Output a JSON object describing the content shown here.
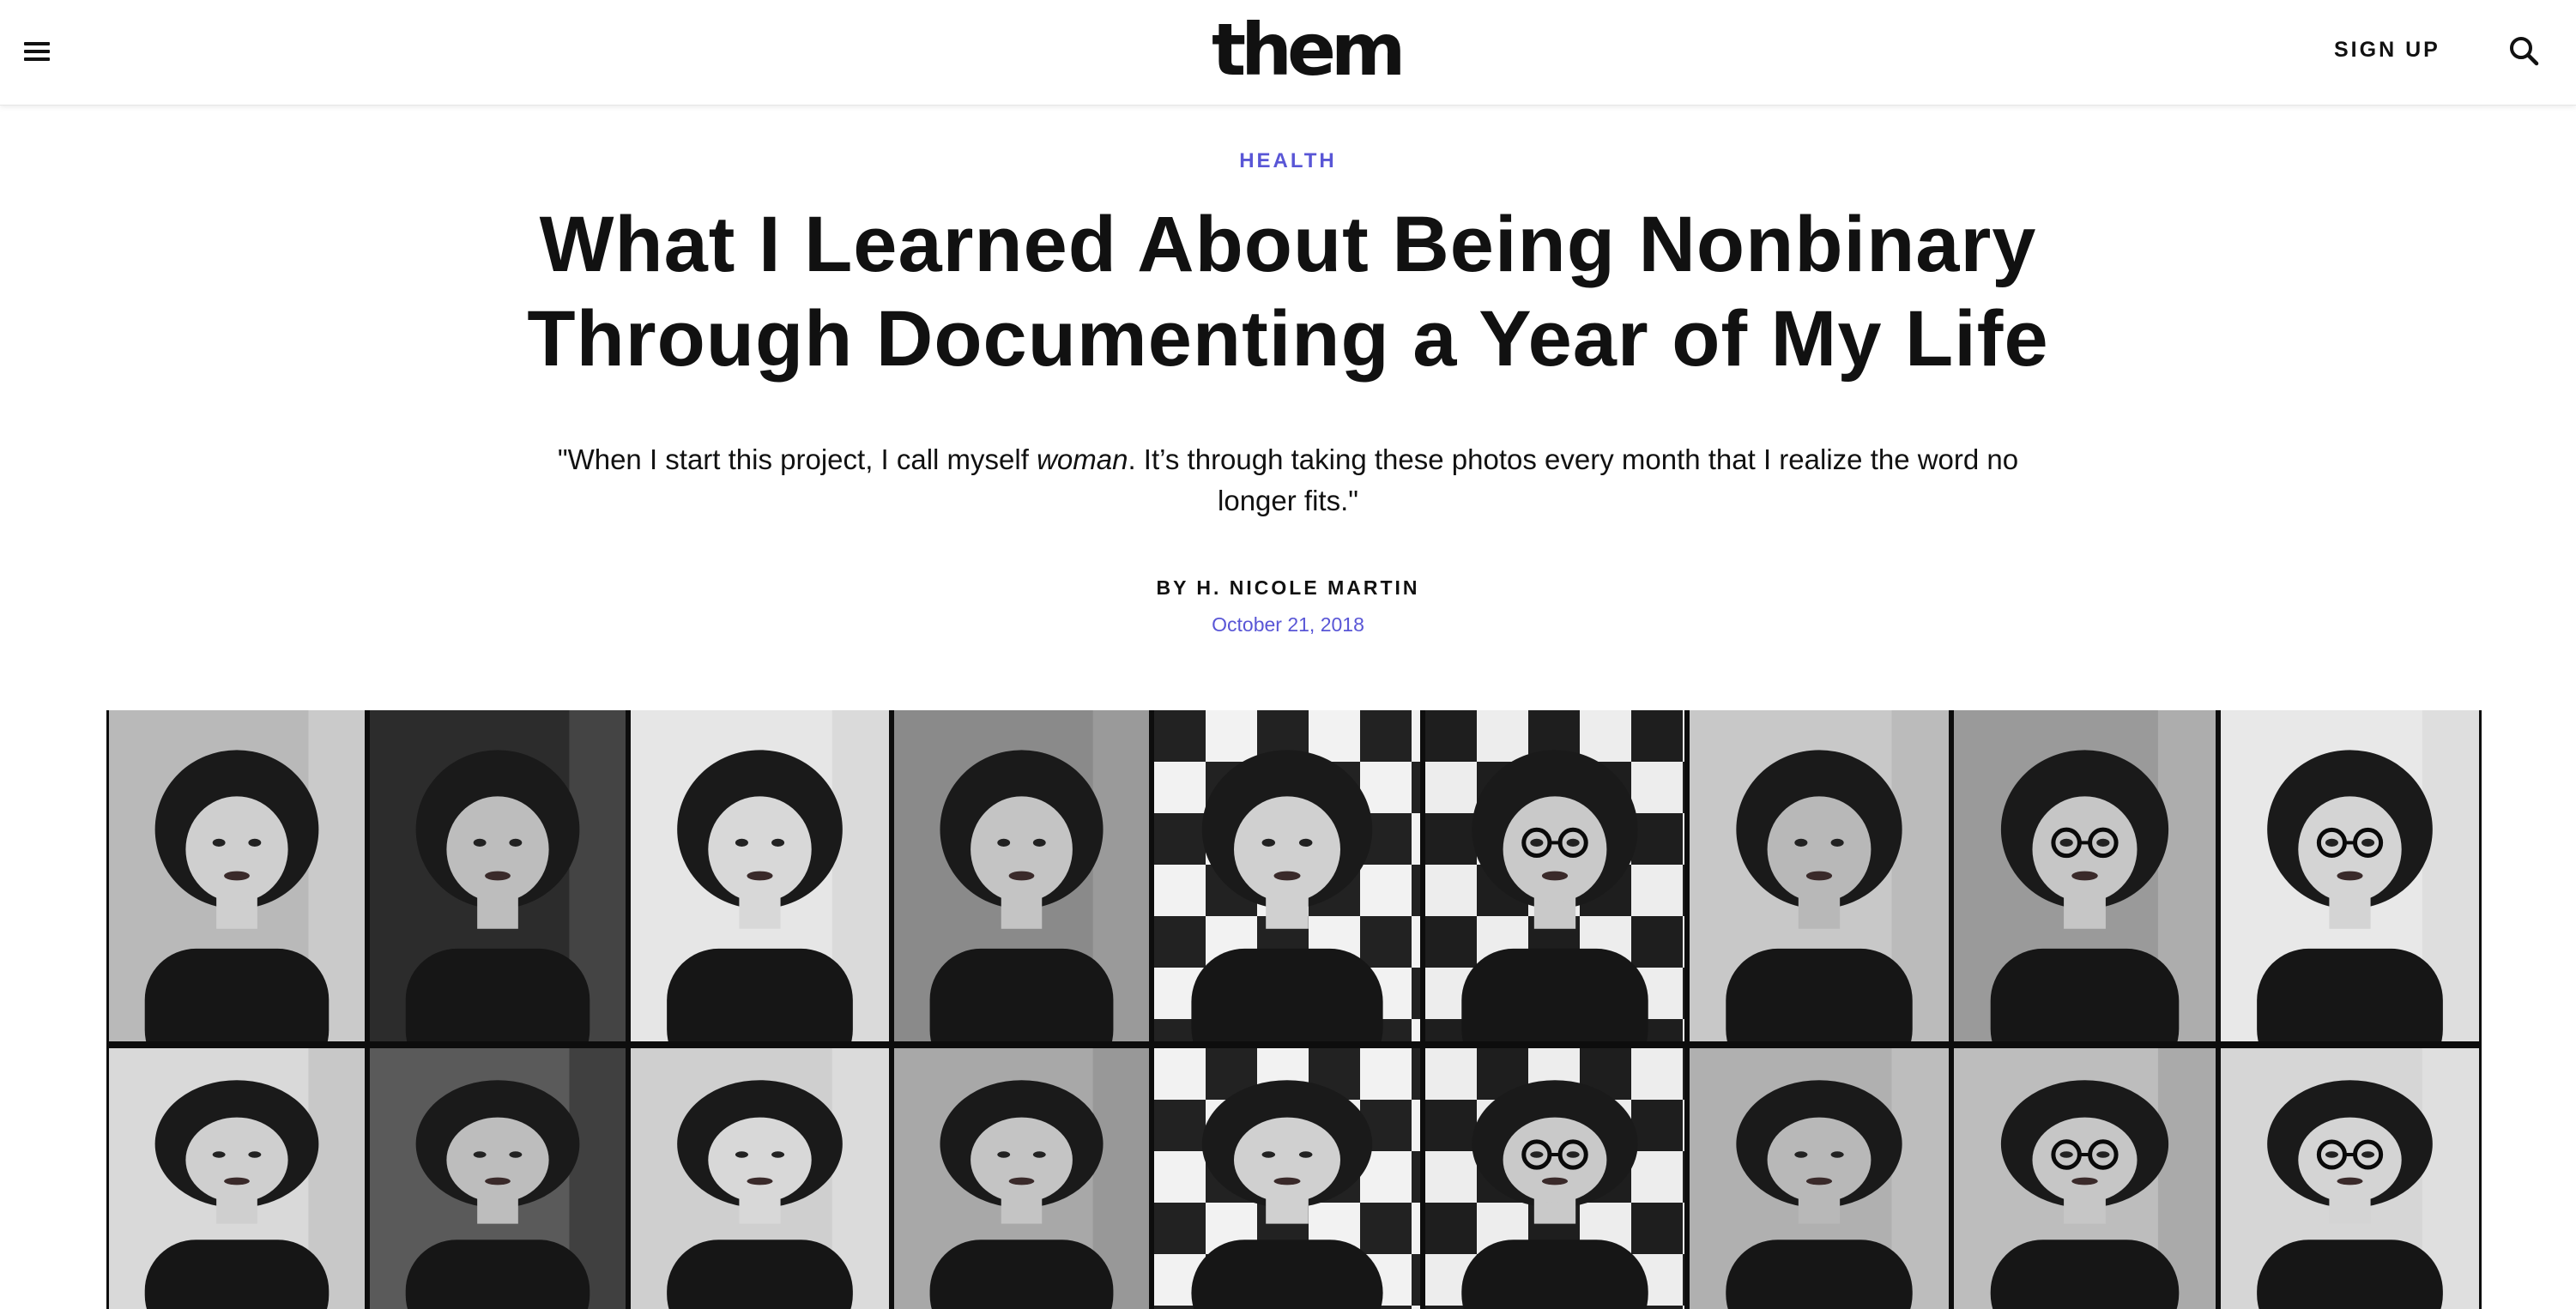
{
  "header": {
    "menu_icon": "hamburger-menu-icon",
    "logo_text": "them",
    "signup_label": "SIGN UP",
    "search_icon": "magnifier-icon"
  },
  "article": {
    "section": "HEALTH",
    "title_line1": "What I Learned About Being Nonbinary",
    "title_line2": "Through Documenting a Year of My Life",
    "dek_before": "\"When I start this project, I call myself ",
    "dek_emphasis": "woman",
    "dek_after": ". It’s through taking these photos every month that I realize the word no longer fits.\"",
    "byline_prefix": "BY ",
    "author": "H. NICOLE MARTIN",
    "date": "October 21, 2018"
  },
  "hero": {
    "description_hidden": false,
    "strip_count": 9,
    "accent_color": "#5956d6"
  }
}
